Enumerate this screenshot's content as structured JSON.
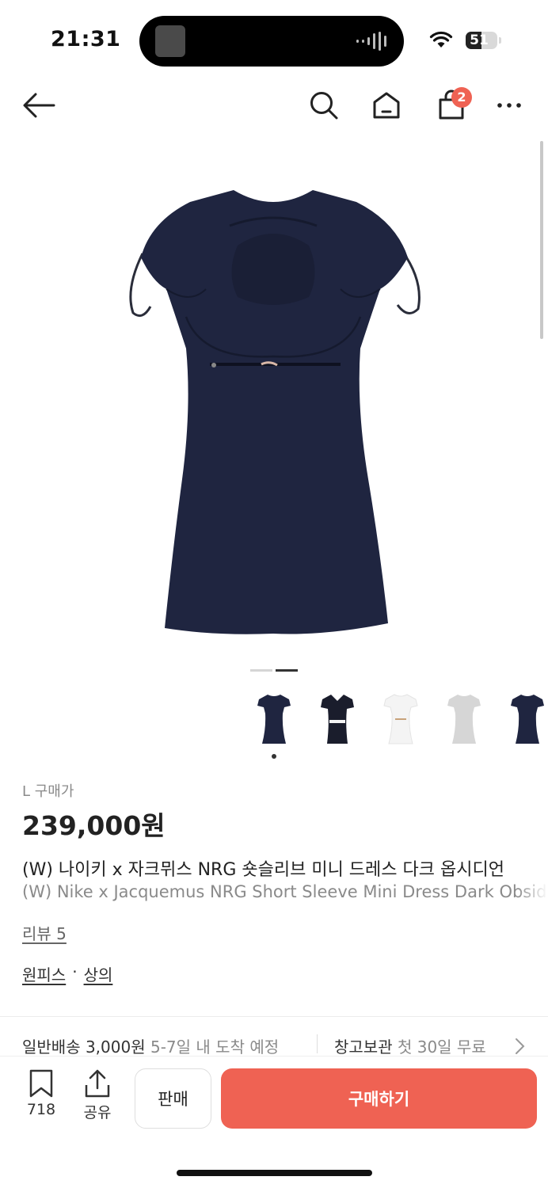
{
  "status_bar": {
    "time": "21:31",
    "battery": "51",
    "battery_level": 0.51
  },
  "nav": {
    "cart_count": "2"
  },
  "gallery": {
    "page_count": 2,
    "active_page": 2
  },
  "thumbnails": [
    {
      "name": "navy-mini-dress",
      "color": "#1f2540",
      "selected": true
    },
    {
      "name": "navy-polo-dress",
      "color": "#1a1d2c",
      "selected": false
    },
    {
      "name": "white-mini-dress",
      "color": "#f4f4f4",
      "selected": false
    },
    {
      "name": "grey-mini-dress",
      "color": "#d6d6d6",
      "selected": false
    },
    {
      "name": "navy-mini-dress-2",
      "color": "#1f2540",
      "selected": false
    }
  ],
  "product": {
    "size_label": "L 구매가",
    "price": "239,000원",
    "name_ko": "(W) 나이키 x 자크뮈스 NRG 숏슬리브 미니 드레스 다크 옵시디언",
    "name_en": "(W) Nike x Jacquemus NRG Short Sleeve Mini Dress Dark Obsidian",
    "review": "리뷰 5",
    "category_1": "원피스",
    "category_sep": "·",
    "category_2": "상의"
  },
  "shipping": {
    "label": "일반배송 3,000원",
    "eta": "5-7일 내 도착 예정",
    "storage_label": "창고보관",
    "storage_note": "첫 30일 무료"
  },
  "bottom": {
    "wishlist_count": "718",
    "share_label": "공유",
    "sell_label": "판매",
    "buy_label": "구매하기"
  },
  "colors": {
    "accent": "#ef6253",
    "dress": "#1f2540"
  }
}
